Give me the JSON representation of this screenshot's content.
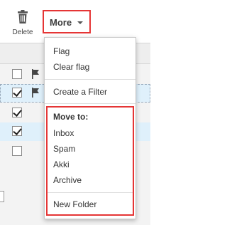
{
  "toolbar": {
    "delete_label": "Delete",
    "more_label": "More"
  },
  "menu": {
    "flag": "Flag",
    "clear_flag": "Clear flag",
    "create_filter": "Create a Filter",
    "move_to_heading": "Move to:",
    "folders": [
      "Inbox",
      "Spam",
      "Akki",
      "Archive"
    ],
    "new_folder": "New Folder"
  },
  "message_rows": [
    {
      "checked": false,
      "flagged": true,
      "selected": false
    },
    {
      "checked": true,
      "flagged": true,
      "selected": true
    },
    {
      "checked": true,
      "flagged": false,
      "selected": false
    },
    {
      "checked": true,
      "flagged": false,
      "selected": true
    },
    {
      "checked": false,
      "flagged": false,
      "selected": false
    }
  ],
  "colors": {
    "highlight_border": "#e53535",
    "selected_row": "#dff0fb"
  }
}
